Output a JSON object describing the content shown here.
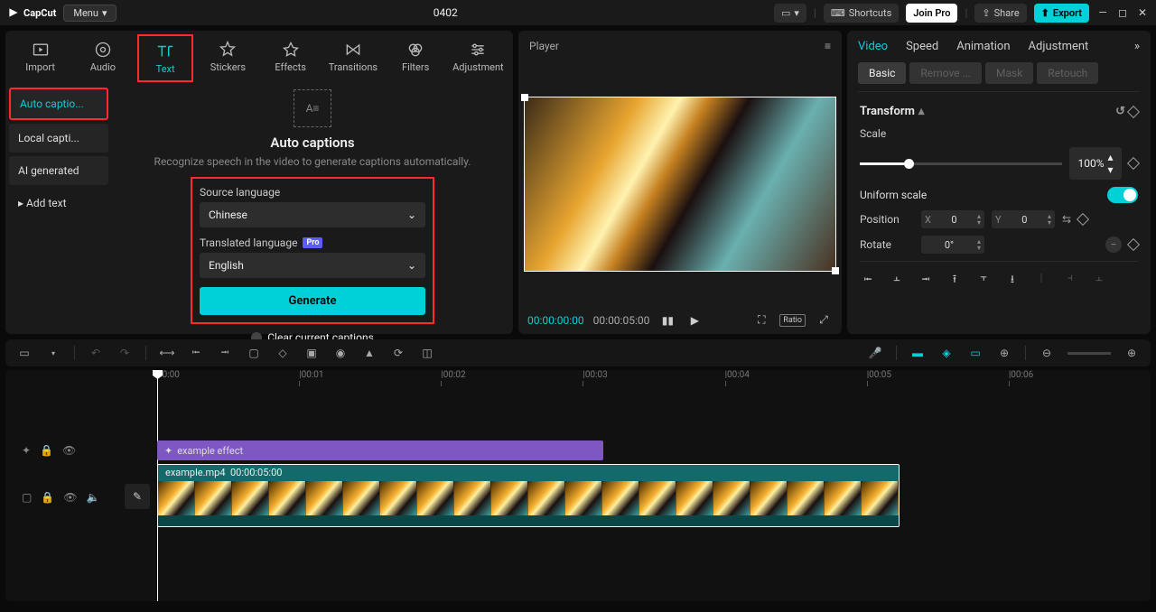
{
  "titlebar": {
    "app_name": "CapCut",
    "menu_label": "Menu",
    "project_title": "0402",
    "shortcuts_label": "Shortcuts",
    "join_pro_label": "Join Pro",
    "share_label": "Share",
    "export_label": "Export"
  },
  "media_tabs": [
    {
      "label": "Import"
    },
    {
      "label": "Audio"
    },
    {
      "label": "Text"
    },
    {
      "label": "Stickers"
    },
    {
      "label": "Effects"
    },
    {
      "label": "Transitions"
    },
    {
      "label": "Filters"
    },
    {
      "label": "Adjustment"
    }
  ],
  "text_sidebar": [
    {
      "label": "Auto captio..."
    },
    {
      "label": "Local capti..."
    },
    {
      "label": "AI generated"
    },
    {
      "label": "▸ Add text"
    }
  ],
  "auto_captions": {
    "title": "Auto captions",
    "description": "Recognize speech in the video to generate captions automatically.",
    "source_lang_label": "Source language",
    "source_lang_value": "Chinese",
    "translated_lang_label": "Translated language",
    "translated_lang_value": "English",
    "pro_badge": "Pro",
    "generate_label": "Generate",
    "clear_label": "Clear current captions"
  },
  "player": {
    "header": "Player",
    "current_time": "00:00:00:00",
    "duration": "00:00:05:00",
    "ratio_label": "Ratio"
  },
  "inspector": {
    "tabs": [
      "Video",
      "Speed",
      "Animation",
      "Adjustment"
    ],
    "subtabs": [
      "Basic",
      "Remove ...",
      "Mask",
      "Retouch"
    ],
    "transform_label": "Transform",
    "scale_label": "Scale",
    "scale_value": "100%",
    "uniform_scale_label": "Uniform scale",
    "position_label": "Position",
    "pos_x_label": "X",
    "pos_x_value": "0",
    "pos_y_label": "Y",
    "pos_y_value": "0",
    "rotate_label": "Rotate",
    "rotate_value": "0°"
  },
  "timeline": {
    "ruler_ticks": [
      "00:00",
      "|00:01",
      "|00:02",
      "|00:03",
      "|00:04",
      "|00:05",
      "|00:06"
    ],
    "effect_clip_name": "example effect",
    "video_clip_name": "example.mp4",
    "video_clip_duration": "00:00:05:00"
  }
}
